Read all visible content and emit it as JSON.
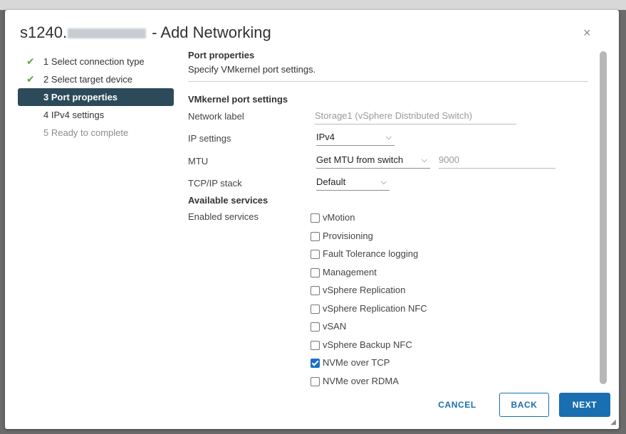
{
  "dialog": {
    "title_prefix": "s1240.",
    "title_suffix": " - Add Networking",
    "close_label": "×"
  },
  "steps": [
    {
      "label": "1 Select connection type",
      "state": "done"
    },
    {
      "label": "2 Select target device",
      "state": "done"
    },
    {
      "label": "3 Port properties",
      "state": "active"
    },
    {
      "label": "4 IPv4 settings",
      "state": "pending"
    },
    {
      "label": "5 Ready to complete",
      "state": "disabled"
    }
  ],
  "step_check": "✔",
  "header": {
    "title": "Port properties",
    "subtitle": "Specify VMkernel port settings."
  },
  "vmk": {
    "section_title": "VMkernel port settings",
    "network_label": "Network label",
    "network_value": "Storage1 (vSphere Distributed Switch)",
    "ip_settings_label": "IP settings",
    "ip_settings_value": "IPv4",
    "mtu_label": "MTU",
    "mtu_select": "Get MTU from switch",
    "mtu_value": "9000",
    "tcpip_label": "TCP/IP stack",
    "tcpip_value": "Default"
  },
  "services": {
    "section_title": "Available services",
    "enabled_label": "Enabled services",
    "items": [
      {
        "label": "vMotion",
        "checked": false
      },
      {
        "label": "Provisioning",
        "checked": false
      },
      {
        "label": "Fault Tolerance logging",
        "checked": false
      },
      {
        "label": "Management",
        "checked": false
      },
      {
        "label": "vSphere Replication",
        "checked": false
      },
      {
        "label": "vSphere Replication NFC",
        "checked": false
      },
      {
        "label": "vSAN",
        "checked": false
      },
      {
        "label": "vSphere Backup NFC",
        "checked": false
      },
      {
        "label": "NVMe over TCP",
        "checked": true
      },
      {
        "label": "NVMe over RDMA",
        "checked": false
      }
    ]
  },
  "chevron": "⌵",
  "buttons": {
    "cancel": "CANCEL",
    "back": "BACK",
    "next": "NEXT"
  },
  "colors": {
    "accent": "#1a6fb0",
    "active_step_bg": "#2d4a5a",
    "check_green": "#5fa83c"
  }
}
